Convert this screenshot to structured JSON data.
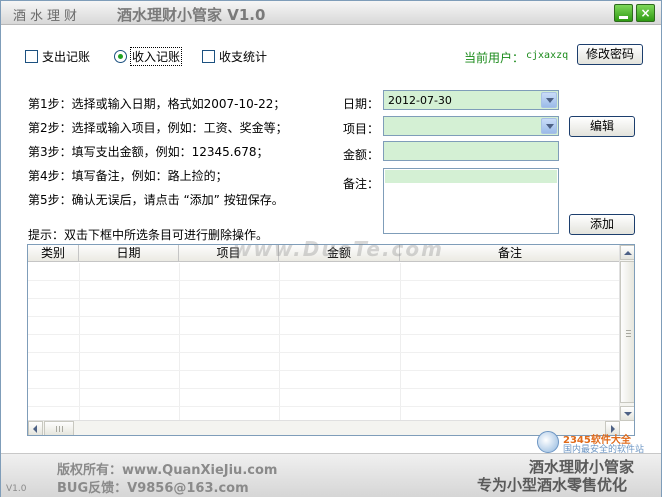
{
  "window": {
    "left_title": "酒水理财",
    "title": "酒水理财小管家 V1.0",
    "minimize_label": "_",
    "close_label": "×"
  },
  "modes": {
    "expense": "支出记账",
    "income": "收入记账",
    "stats": "收支统计",
    "selected": "income"
  },
  "user": {
    "label": "当前用户：",
    "name": "cjxaxzq",
    "change_password": "修改密码"
  },
  "steps": [
    "第1步：选择或输入日期，格式如2007-10-22；",
    "第2步：选择或输入项目，例如：工资、奖金等；",
    "第3步：填写支出金额，例如：12345.678；",
    "第4步：填写备注，例如：路上捡的；",
    "第5步：确认无误后，请点击 “添加” 按钮保存。"
  ],
  "form": {
    "date_label": "日期：",
    "date_value": "2012-07-30",
    "item_label": "项目：",
    "item_value": "",
    "amount_label": "金额：",
    "amount_value": "",
    "note_label": "备注：",
    "note_value": "",
    "edit_button": "编辑",
    "add_button": "添加"
  },
  "hint": "提示：双击下框中所选条目可进行删除操作。",
  "table": {
    "columns": [
      "类别",
      "日期",
      "项目",
      "金额",
      "备注"
    ],
    "rows": []
  },
  "watermark": "www.DuoTe.com",
  "footer": {
    "version": "V1.0",
    "copyright": "版权所有：www.QuanXieJiu.com",
    "bug": "BUG反馈：V9856@163.com",
    "brand1": "酒水理财小管家",
    "brand2": "专为小型酒水零售优化"
  },
  "badge": {
    "title": "2345软件大全",
    "sub": "国内最安全的软件站"
  },
  "colors": {
    "field_bg": "#d4f0d4",
    "accent_green": "#2e9a12",
    "user_text": "#1a8a1a"
  }
}
